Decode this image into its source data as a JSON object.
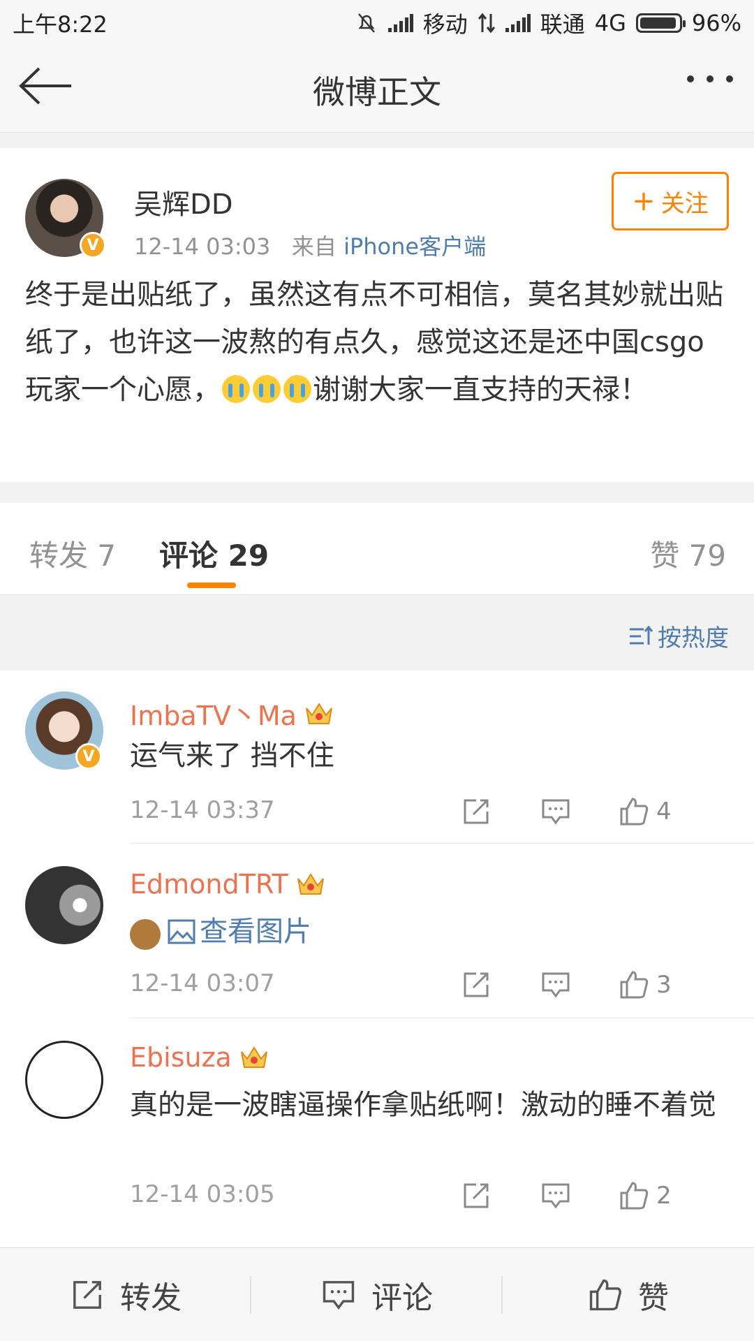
{
  "status_bar": {
    "time": "上午8:22",
    "carrier1": "移动",
    "carrier2": "联通",
    "network": "4G",
    "battery": "96%"
  },
  "nav": {
    "title": "微博正文",
    "icons": [
      "back-arrow-icon",
      "more-dots-icon"
    ]
  },
  "post": {
    "author": "吴辉DD",
    "time": "12-14 03:03",
    "via": "来自",
    "source": "iPhone客户端",
    "follow_label": "关注",
    "text_part1": "终于是出贴纸了，虽然这有点不可相信，莫名其妙就出贴纸了，也许这一波熬的有点久，感觉这还是还中国csgo玩家一个心愿，",
    "text_part2": "谢谢大家一直支持的天禄！",
    "emoji_name": "crying-emoji"
  },
  "tabs": {
    "repost": "转发 7",
    "comments": "评论 29",
    "likes": "赞 79"
  },
  "sort_label": "按热度",
  "comments": [
    {
      "name": "ImbaTV丶Ma",
      "text": "运气来了 挡不住",
      "time": "12-14 03:37",
      "likes": "4"
    },
    {
      "name": "EdmondTRT",
      "text": "查看图片",
      "time": "12-14 03:07",
      "likes": "3"
    },
    {
      "name": "Ebisuza",
      "text": "真的是一波瞎逼操作拿贴纸啊！激动的睡不着觉",
      "time": "12-14 03:05",
      "likes": "2"
    }
  ],
  "bottom_bar": {
    "repost": "转发",
    "comment": "评论",
    "like": "赞"
  },
  "colors": {
    "accent_orange": "#ff8200",
    "link_blue": "#507daf",
    "username_orange": "#eb7350",
    "verified_badge": "#f5a623"
  }
}
